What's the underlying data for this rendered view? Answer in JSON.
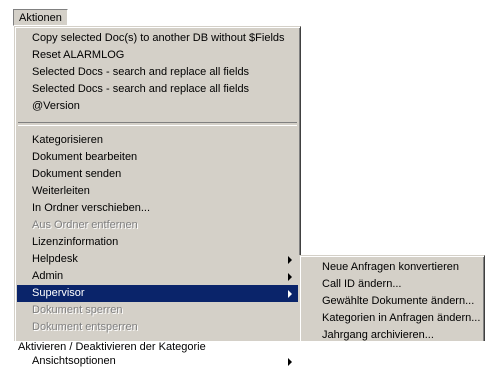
{
  "menubar": {
    "title": "Aktionen"
  },
  "main_menu": {
    "group1": [
      {
        "label": "Copy selected Doc(s) to another DB without $Fields",
        "disabled": false
      },
      {
        "label": "Reset ALARMLOG",
        "disabled": false
      },
      {
        "label": "Selected Docs - search and replace all fields",
        "disabled": false
      },
      {
        "label": "Selected Docs - search and replace all fields",
        "disabled": false
      },
      {
        "label": "@Version",
        "disabled": false
      }
    ],
    "group2": [
      {
        "label": "Kategorisieren",
        "disabled": false
      },
      {
        "label": "Dokument bearbeiten",
        "disabled": false
      },
      {
        "label": "Dokument  senden",
        "disabled": false
      },
      {
        "label": "Weiterleiten",
        "disabled": false
      },
      {
        "label": "In Ordner verschieben...",
        "disabled": false
      },
      {
        "label": "Aus Ordner entfernen",
        "disabled": true
      },
      {
        "label": "Lizenzinformation",
        "disabled": false
      },
      {
        "label": "Helpdesk",
        "disabled": false,
        "submenu": true
      },
      {
        "label": "Admin",
        "disabled": false,
        "submenu": true
      },
      {
        "label": "Supervisor",
        "disabled": false,
        "submenu": true,
        "selected": true
      },
      {
        "label": "Dokument sperren",
        "disabled": true
      },
      {
        "label": "Dokument entsperren",
        "disabled": true
      }
    ],
    "group3": [
      {
        "label": "Ansichtsoptionen",
        "disabled": false,
        "submenu": true
      }
    ]
  },
  "supervisor_submenu": [
    {
      "label": "Neue Anfragen konvertieren"
    },
    {
      "label": "Call ID ändern..."
    },
    {
      "label": "Gewählte Dokumente ändern..."
    },
    {
      "label": "Kategorien in Anfragen ändern..."
    },
    {
      "label": "Jahrgang archivieren..."
    }
  ],
  "footer_text": "Aktivieren / Deaktivieren der Kategorie",
  "colors": {
    "menu_bg": "#d4d0c8",
    "highlight": "#0a246a",
    "disabled_text": "#808080"
  }
}
